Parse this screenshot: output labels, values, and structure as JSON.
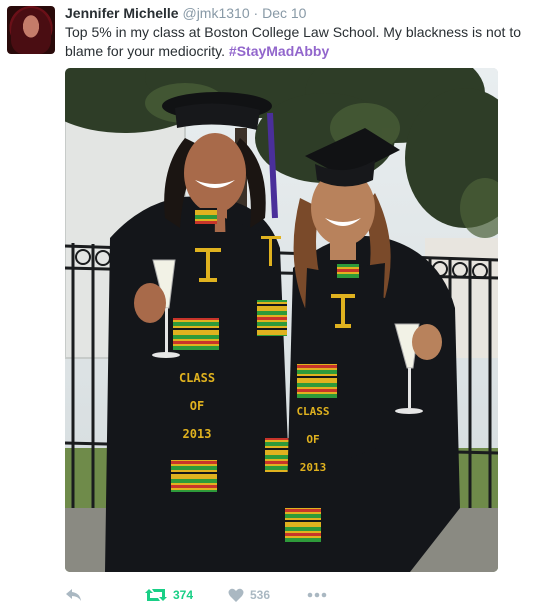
{
  "tweet": {
    "author_name": "Jennifer Michelle",
    "handle": "@jmk1310",
    "separator": "·",
    "date": "Dec 10",
    "text_main": "Top 5% in my class at Boston College Law School. My blackness is not to blame for your mediocrity. ",
    "hashtag": "#StayMadAbby"
  },
  "media": {
    "stole_lines": [
      "CLASS",
      "OF",
      "2013"
    ],
    "colors": {
      "gown": "#14161a",
      "kente_gold": "#e0b21f",
      "kente_green": "#2e9a3a",
      "kente_red": "#c8352a",
      "tassel": "#4a2f9a"
    }
  },
  "actions": {
    "reply_icon": "reply-icon",
    "retweet_icon": "retweet-icon",
    "retweet_count": "374",
    "like_icon": "heart-icon",
    "like_count": "536",
    "more_icon": "more-dots-icon"
  },
  "colors": {
    "hashtag": "#9266cc",
    "retweet": "#19cf86",
    "muted": "#aab8c2",
    "text": "#292f33"
  }
}
